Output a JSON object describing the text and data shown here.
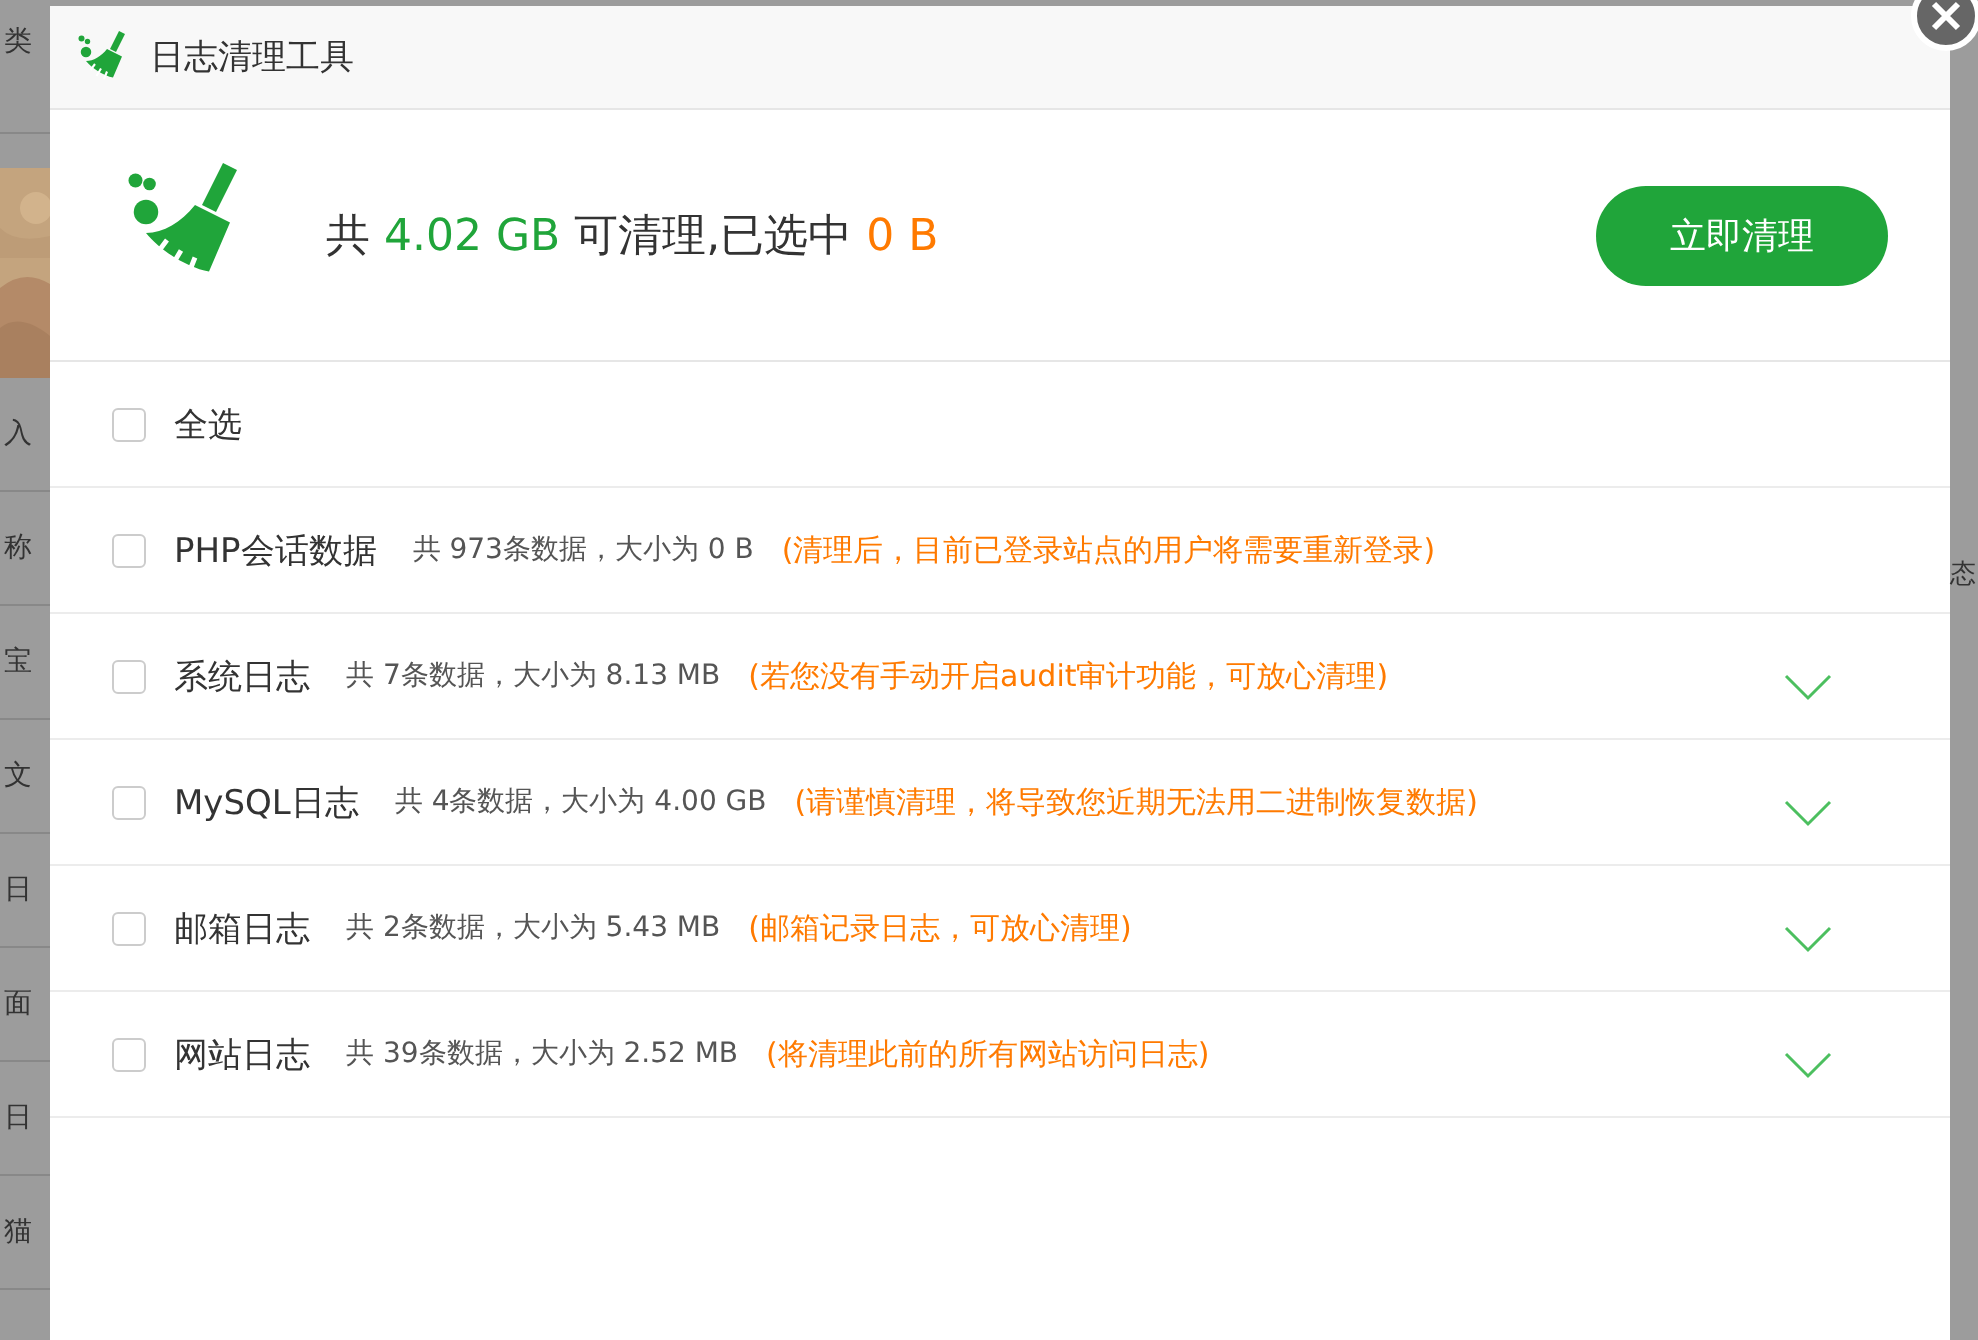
{
  "background": {
    "left_fragments": [
      "类",
      "入",
      "称",
      "宝",
      "文",
      "日",
      "面",
      "日",
      "猫"
    ],
    "right_fragments": [
      "态"
    ]
  },
  "window": {
    "title": "日志清理工具"
  },
  "summary": {
    "prefix": "共",
    "total": "4.02 GB",
    "middle": "可清理,已选中",
    "selected": "0 B",
    "button": "立即清理"
  },
  "select_all": {
    "label": "全选",
    "checked": false
  },
  "items": [
    {
      "name": "PHP会话数据",
      "info": "共 973条数据，大小为 0 B",
      "note": "(清理后，目前已登录站点的用户将需要重新登录)",
      "checked": false,
      "kind": "plain"
    },
    {
      "name": "系统日志",
      "info": "共 7条数据，大小为 8.13 MB",
      "note": "(若您没有手动开启audit审计功能，可放心清理)",
      "checked": false,
      "kind": "expandable",
      "expanded": false
    },
    {
      "name": "MySQL日志",
      "info": "共 4条数据，大小为 4.00 GB",
      "note": "(请谨慎清理，将导致您近期无法用二进制恢复数据)",
      "checked": false,
      "kind": "expandable",
      "expanded": false
    },
    {
      "name": "邮箱日志",
      "info": "共 2条数据，大小为 5.43 MB",
      "note": "(邮箱记录日志，可放心清理)",
      "checked": false,
      "kind": "expandable",
      "expanded": false
    },
    {
      "name": "网站日志",
      "info": "共 39条数据，大小为 2.52 MB",
      "note": "(将清理此前的所有网站访问日志)",
      "checked": false,
      "kind": "expandable",
      "expanded": false
    }
  ]
}
